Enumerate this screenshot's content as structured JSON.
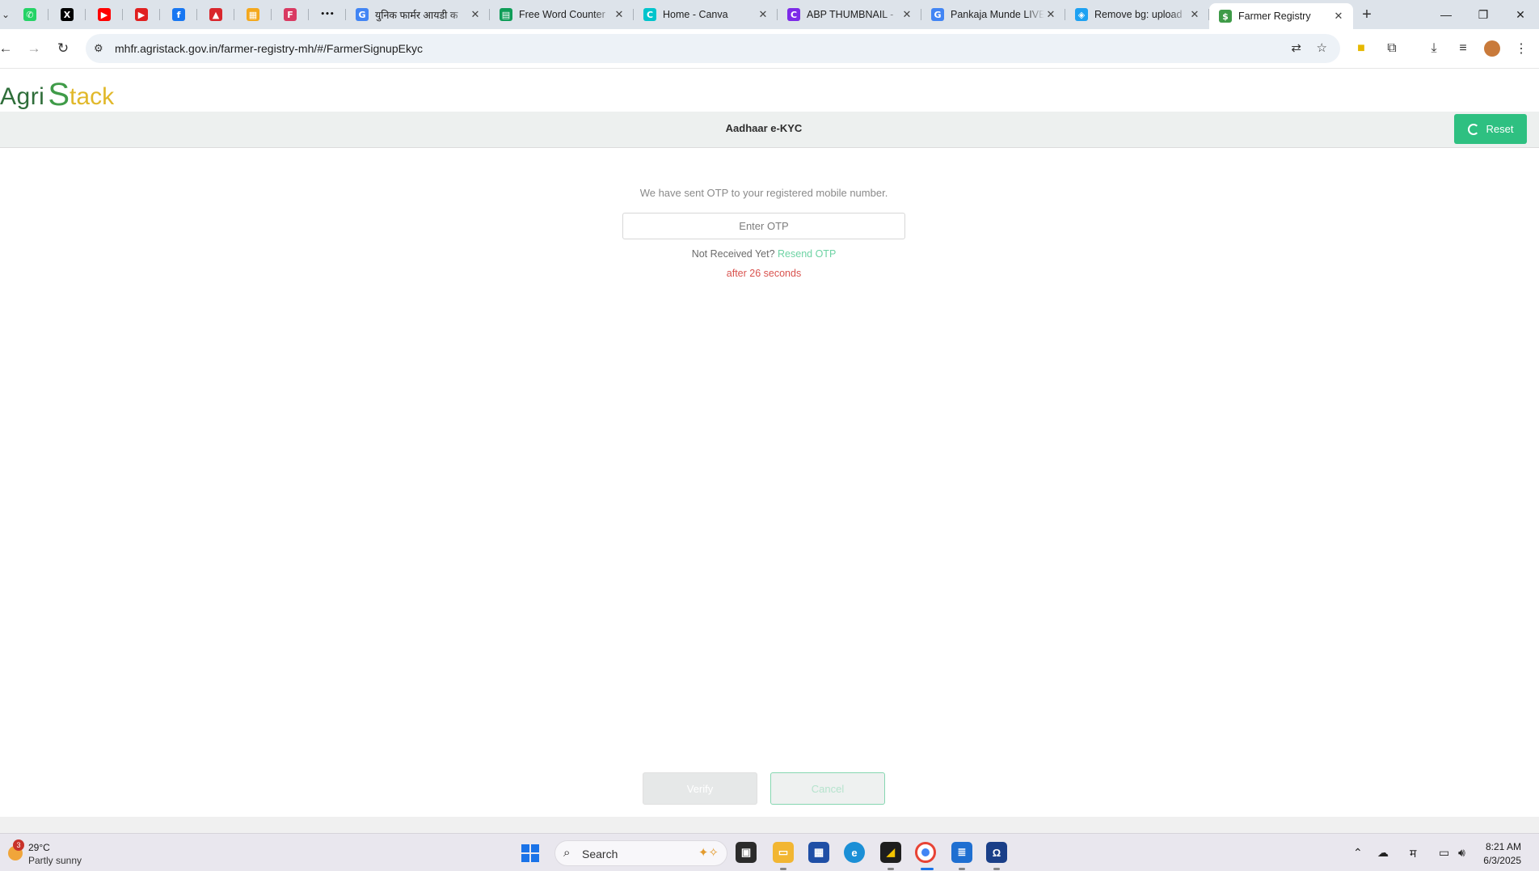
{
  "browser": {
    "pinned_tabs": [
      {
        "icon": "whatsapp-icon",
        "color": "#25d366",
        "glyph": "✆"
      },
      {
        "icon": "x-icon",
        "color": "#000000",
        "glyph": "X"
      },
      {
        "icon": "youtube-icon",
        "color": "#ff0000",
        "glyph": "▶"
      },
      {
        "icon": "youtube-icon",
        "color": "#e02020",
        "glyph": "▶"
      },
      {
        "icon": "facebook-icon",
        "color": "#1877f2",
        "glyph": "f"
      },
      {
        "icon": "acrobat-icon",
        "color": "#d9262c",
        "glyph": "▲"
      },
      {
        "icon": "apps-icon",
        "color": "#f4a81d",
        "glyph": "▦"
      },
      {
        "icon": "f-app-icon",
        "color": "#d93a62",
        "glyph": "F"
      },
      {
        "icon": "more-icon",
        "color": "#111111",
        "glyph": "•••"
      }
    ],
    "tabs": [
      {
        "title": "युनिक फार्मर आयडी क",
        "icon": "google-icon",
        "icon_color": "#4285f4",
        "glyph": "G"
      },
      {
        "title": "Free Word Counter",
        "icon": "sheets-icon",
        "icon_color": "#0f9d58",
        "glyph": "▤"
      },
      {
        "title": "Home - Canva",
        "icon": "canva-icon",
        "icon_color": "#00c4cc",
        "glyph": "C"
      },
      {
        "title": "ABP THUMBNAIL - ",
        "icon": "canva-icon",
        "icon_color": "#7d2ae8",
        "glyph": "C"
      },
      {
        "title": "Pankaja Munde LIVE",
        "icon": "google-icon",
        "icon_color": "#4285f4",
        "glyph": "G"
      },
      {
        "title": "Remove bg: upload",
        "icon": "removebg-icon",
        "icon_color": "#1da1f2",
        "glyph": "◈"
      },
      {
        "title": "Farmer Registry",
        "icon": "dollar-green-icon",
        "icon_color": "#3f9b48",
        "glyph": "$",
        "active": true
      }
    ],
    "url": "mhfr.agristack.gov.in/farmer-registry-mh/#/FarmerSignupEkyc"
  },
  "page": {
    "logo_part1": "Agri",
    "logo_mark": "S",
    "logo_part2": "tack",
    "header_title": "Aadhaar e-KYC",
    "reset_label": "Reset",
    "otp_message": "We have sent OTP to your registered mobile number.",
    "otp_placeholder": "Enter OTP",
    "not_received": "Not Received Yet?",
    "resend_label": "Resend OTP",
    "timer_text": "after 26 seconds",
    "verify_label": "Verify",
    "cancel_label": "Cancel",
    "colors": {
      "accent": "#2ec081",
      "timer": "#d9534f"
    }
  },
  "taskbar": {
    "weather_badge": "3",
    "weather_temp": "29°C",
    "weather_desc": "Partly sunny",
    "search_label": "Search",
    "time": "8:21 AM",
    "date": "6/3/2025",
    "ime": "म"
  }
}
